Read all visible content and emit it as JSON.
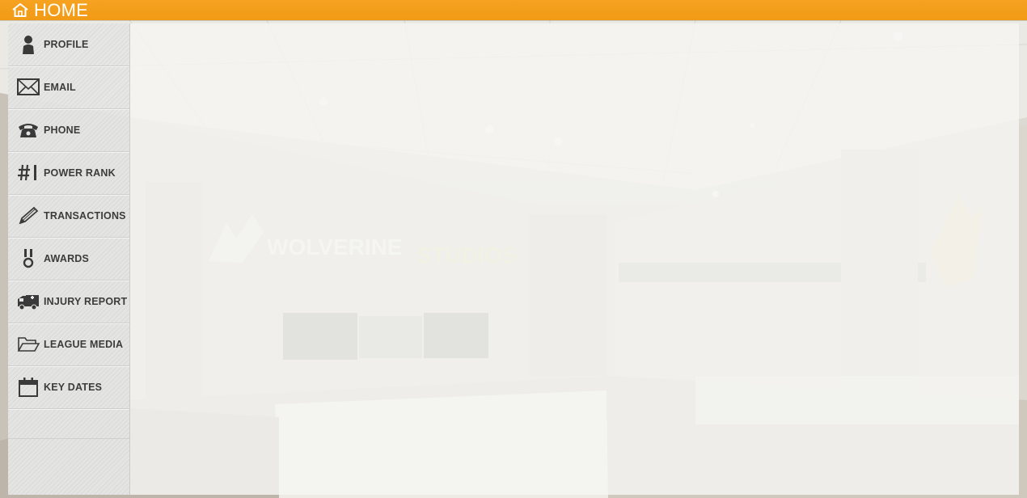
{
  "header": {
    "title": "HOME",
    "icon": "home-icon"
  },
  "brand": {
    "logo_text_primary": "WOLVERINE",
    "logo_text_secondary": "STUDIOS",
    "accent": "#f29d1a"
  },
  "sidebar": {
    "items": [
      {
        "label": "PROFILE",
        "icon": "person-icon"
      },
      {
        "label": "EMAIL",
        "icon": "envelope-icon"
      },
      {
        "label": "PHONE",
        "icon": "phone-icon"
      },
      {
        "label": "POWER RANK",
        "icon": "hash-rank-icon"
      },
      {
        "label": "TRANSACTIONS",
        "icon": "pencil-icon"
      },
      {
        "label": "AWARDS",
        "icon": "medal-icon"
      },
      {
        "label": "INJURY REPORT",
        "icon": "ambulance-icon"
      },
      {
        "label": "LEAGUE MEDIA",
        "icon": "folder-icon"
      },
      {
        "label": "KEY DATES",
        "icon": "calendar-icon"
      }
    ]
  }
}
